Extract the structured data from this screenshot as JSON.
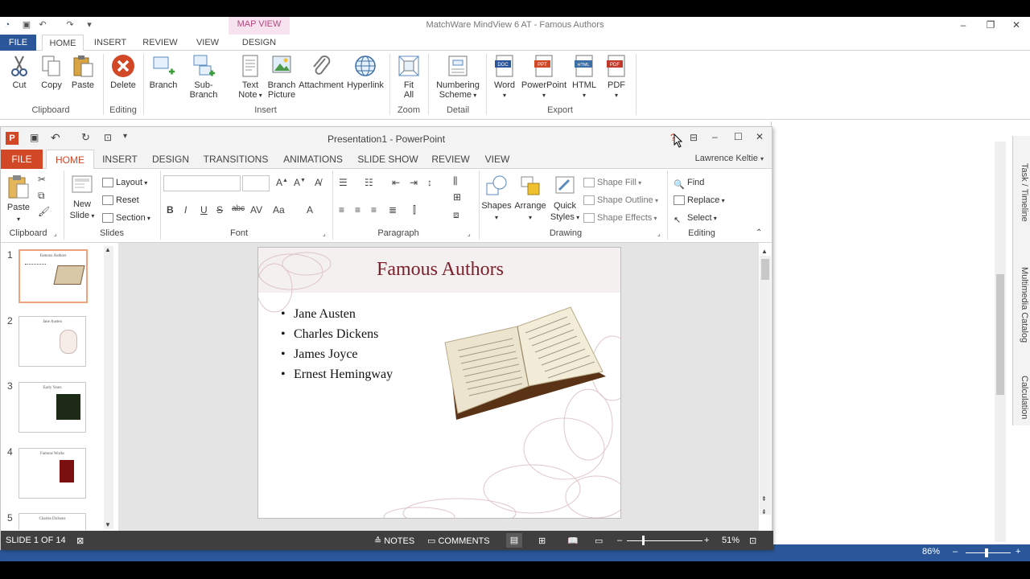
{
  "mindview": {
    "title": "MatchWare MindView 6 AT - Famous Authors",
    "contextual_tab_header": "MAP VIEW",
    "tabs": [
      "FILE",
      "HOME",
      "INSERT",
      "REVIEW",
      "VIEW",
      "DESIGN"
    ],
    "ribbon": {
      "cut": "Cut",
      "copy": "Copy",
      "paste": "Paste",
      "clipboard_group": "Clipboard",
      "delete": "Delete",
      "editing_group": "Editing",
      "branch": "Branch",
      "sub_branch": "Sub-Branch",
      "text_note_1": "Text",
      "text_note_2": "Note",
      "branch_picture_1": "Branch",
      "branch_picture_2": "Picture",
      "attachment": "Attachment",
      "hyperlink": "Hyperlink",
      "insert_group": "Insert",
      "fit_all_1": "Fit",
      "fit_all_2": "All",
      "zoom_group": "Zoom",
      "numbering_1": "Numbering",
      "numbering_2": "Scheme",
      "detail_group": "Detail",
      "word": "Word",
      "powerpoint": "PowerPoint",
      "html": "HTML",
      "pdf": "PDF",
      "export_group": "Export"
    },
    "side_tabs": [
      "Task / Timeline",
      "Multimedia Catalog",
      "Calculation"
    ],
    "zoom": "86%",
    "help": "?"
  },
  "powerpoint": {
    "title": "Presentation1 - PowerPoint",
    "user": "Lawrence Keltie",
    "tabs": [
      "FILE",
      "HOME",
      "INSERT",
      "DESIGN",
      "TRANSITIONS",
      "ANIMATIONS",
      "SLIDE SHOW",
      "REVIEW",
      "VIEW"
    ],
    "ribbon": {
      "paste": "Paste",
      "clipboard_group": "Clipboard",
      "new_slide_1": "New",
      "new_slide_2": "Slide",
      "layout": "Layout",
      "reset": "Reset",
      "section": "Section",
      "slides_group": "Slides",
      "font_group": "Font",
      "paragraph_group": "Paragraph",
      "shapes": "Shapes",
      "arrange": "Arrange",
      "quick_styles_1": "Quick",
      "quick_styles_2": "Styles",
      "shape_fill": "Shape Fill",
      "shape_outline": "Shape Outline",
      "shape_effects": "Shape Effects",
      "drawing_group": "Drawing",
      "find": "Find",
      "replace": "Replace",
      "select": "Select",
      "editing_group": "Editing"
    },
    "thumbnails": [
      {
        "num": "1",
        "title": "Famous Authors"
      },
      {
        "num": "2",
        "title": "Jane Austen"
      },
      {
        "num": "3",
        "title": "Early Years"
      },
      {
        "num": "4",
        "title": "Famous Works"
      },
      {
        "num": "5",
        "title": "Charles Dickens"
      }
    ],
    "slide": {
      "title": "Famous Authors",
      "bullets": [
        "Jane Austen",
        "Charles Dickens",
        "James Joyce",
        "Ernest Hemingway"
      ]
    },
    "status": {
      "slide_count": "SLIDE 1 OF 14",
      "notes": "NOTES",
      "comments": "COMMENTS",
      "zoom": "51%"
    }
  }
}
